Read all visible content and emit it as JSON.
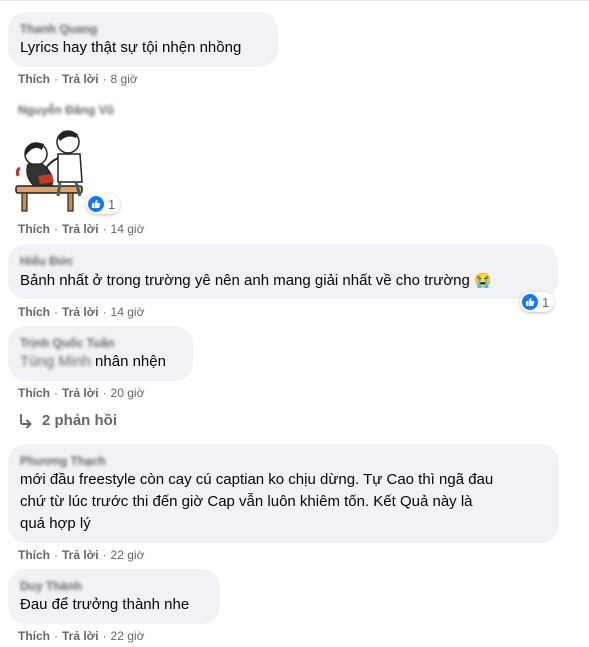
{
  "actions": {
    "like": "Thích",
    "reply": "Trả lời",
    "separator": "·"
  },
  "comments": [
    {
      "author": "Thanh Quang",
      "text": "Lyrics hay thật sự tội nhện nhồng",
      "time": "8 giờ"
    },
    {
      "author": "Nguyễn Đăng Vũ",
      "sticker": "sticker-two-boys-bench",
      "reaction_count": "1",
      "time": "14 giờ"
    },
    {
      "author": "Hiếu Đức",
      "text": "Bảnh nhất ở trong trường yê nên anh mang giải nhất về cho trường",
      "emoji": "😭",
      "reaction_count": "1",
      "time": "14 giờ"
    },
    {
      "author": "Trịnh Quốc Tuấn",
      "mention": "Tùng Minh",
      "text": " nhân nhện",
      "time": "20 giờ",
      "replies_label": "2 phản hồi"
    },
    {
      "author": "Phương Thạch",
      "text_lines": [
        "mới đầu freestyle còn cay cú captian ko chịu dừng. Tự Cao thì ngã đau",
        "chứ từ lúc trước thi đến giờ Cap vẫn luôn khiêm tốn. Kết Quả này là",
        "quá hợp lý"
      ],
      "time": "22 giờ"
    },
    {
      "author": "Duy Thành",
      "text": "Đau để trưởng thành nhe",
      "time": "22 giờ"
    }
  ],
  "colors": {
    "bubble": "#f0f2f5",
    "secondary_text": "#65676b",
    "like_blue": "#1877f2"
  }
}
